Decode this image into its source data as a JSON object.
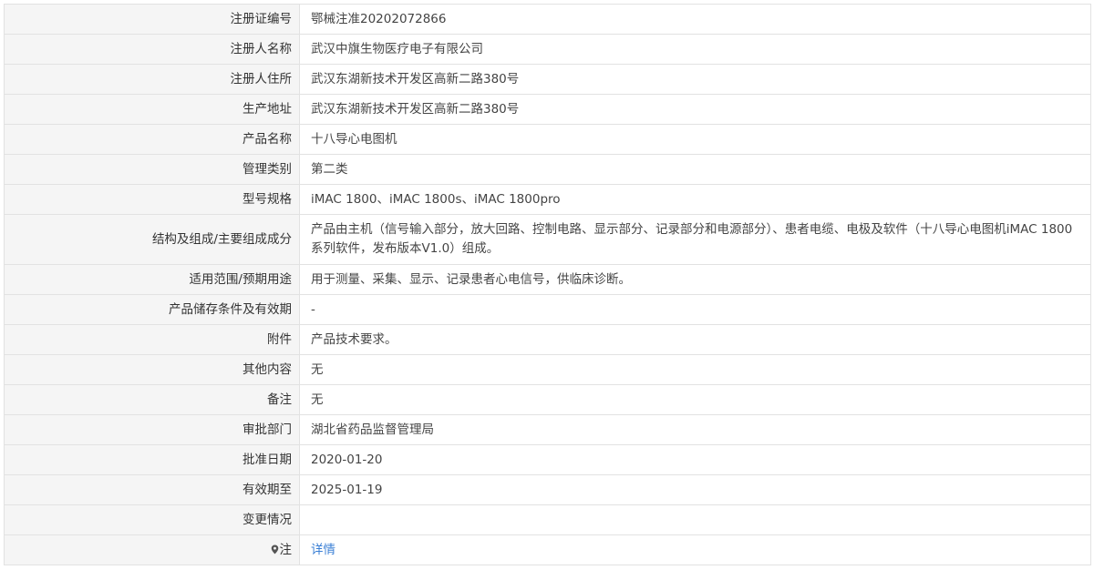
{
  "rows": [
    {
      "label": "注册证编号",
      "value": "鄂械注准20202072866"
    },
    {
      "label": "注册人名称",
      "value": "武汉中旗生物医疗电子有限公司"
    },
    {
      "label": "注册人住所",
      "value": "武汉东湖新技术开发区高新二路380号"
    },
    {
      "label": "生产地址",
      "value": "武汉东湖新技术开发区高新二路380号"
    },
    {
      "label": "产品名称",
      "value": "十八导心电图机"
    },
    {
      "label": "管理类别",
      "value": "第二类"
    },
    {
      "label": "型号规格",
      "value": "iMAC 1800、iMAC 1800s、iMAC 1800pro"
    },
    {
      "label": "结构及组成/主要组成成分",
      "value": "产品由主机（信号输入部分，放大回路、控制电路、显示部分、记录部分和电源部分）、患者电缆、电极及软件（十八导心电图机iMAC 1800系列软件，发布版本V1.0）组成。"
    },
    {
      "label": "适用范围/预期用途",
      "value": "用于测量、采集、显示、记录患者心电信号，供临床诊断。"
    },
    {
      "label": "产品储存条件及有效期",
      "value": "-"
    },
    {
      "label": "附件",
      "value": "产品技术要求。"
    },
    {
      "label": "其他内容",
      "value": "无"
    },
    {
      "label": "备注",
      "value": "无"
    },
    {
      "label": "审批部门",
      "value": "湖北省药品监督管理局"
    },
    {
      "label": "批准日期",
      "value": "2020-01-20"
    },
    {
      "label": "有效期至",
      "value": "2025-01-19"
    },
    {
      "label": "变更情况",
      "value": ""
    }
  ],
  "note": {
    "label": "注",
    "icon": "location-pin-icon",
    "link_text": "详情",
    "link_color": "#3a7fd5"
  }
}
